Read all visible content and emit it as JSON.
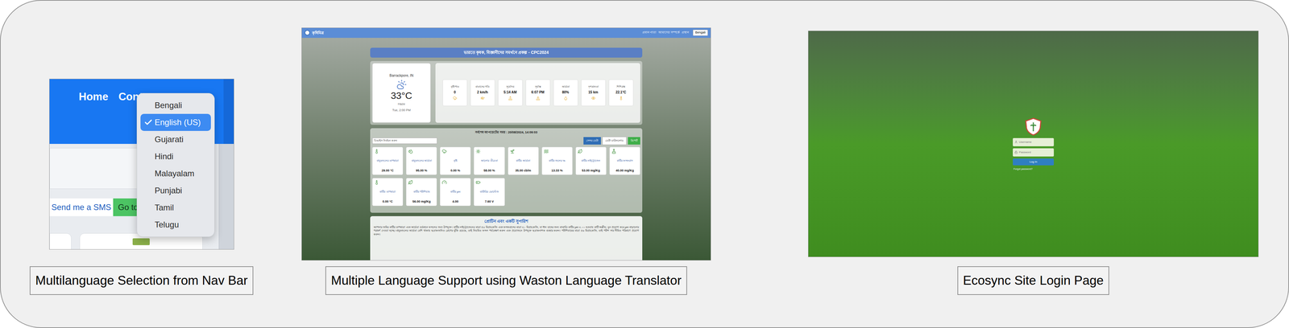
{
  "nav_demo": {
    "nav": [
      "Home",
      "Cont"
    ],
    "sms_button": "Send me a SMS",
    "go_button": "Go to",
    "language_menu": [
      {
        "label": "Bengali",
        "selected": false
      },
      {
        "label": "English (US)",
        "selected": true
      },
      {
        "label": "Gujarati",
        "selected": false
      },
      {
        "label": "Hindi",
        "selected": false
      },
      {
        "label": "Malayalam",
        "selected": false
      },
      {
        "label": "Punjabi",
        "selected": false
      },
      {
        "label": "Tamil",
        "selected": false
      },
      {
        "label": "Telugu",
        "selected": false
      }
    ]
  },
  "translator_demo": {
    "brand": "কৃষিমিত্র",
    "top_links": [
      "প্রধান পাতা",
      "আমাদের সম্পর্কে",
      "প্রস্থান"
    ],
    "language_select": "Bengali",
    "title": "ভারতে কৃষক, বিজ্ঞানীদের সমর্থনে প্রকল্প - CPC2024",
    "weather": {
      "location": "Barrackpore, IN",
      "temperature": "33°C",
      "condition": "Haze",
      "time": "Tue, 2:00 PM",
      "details": [
        {
          "label": "বৃষ্টিপাত",
          "value": "0"
        },
        {
          "label": "বাতাসের গতি",
          "value": "2 km/h"
        },
        {
          "label": "সূর্যোদয়",
          "value": "5:14 AM"
        },
        {
          "label": "সূর্যাস্ত",
          "value": "6:07 PM"
        },
        {
          "label": "আর্দ্রতা",
          "value": "80%"
        },
        {
          "label": "দৃশ্যমানতা",
          "value": "15 km"
        },
        {
          "label": "শিশিরাঙ্ক",
          "value": "22.1°C"
        }
      ]
    },
    "sensor_header": "সর্বশেষ আপডেটের সময় : 20/08/2024, 14:09:03",
    "device_select": "ডিভাইস নির্বাচন করুন",
    "sensor_buttons": [
      {
        "label": "সেন্সর ডেটা",
        "color": "#2f6db5"
      },
      {
        "label": "ডেটা ডাউনলোড",
        "color": "#ffffff"
      },
      {
        "label": "রিপোর্ট",
        "color": "#3fae49"
      }
    ],
    "sensors": [
      {
        "label": "বায়ুমণ্ডলের তাপমাত্রা",
        "value": "29.00 °C"
      },
      {
        "label": "বায়ুমণ্ডলের আর্দ্রতা",
        "value": "95.00 %"
      },
      {
        "label": "বৃষ্টি",
        "value": "0.00 %"
      },
      {
        "label": "আলোর তীব্রতা",
        "value": "58.00 %"
      },
      {
        "label": "মাটির আর্দ্রতা",
        "value": "35.00 cb/m"
      },
      {
        "label": "মাটির জলের %",
        "value": "13.33 %"
      },
      {
        "label": "মাটির নাইট্রোজেন",
        "value": "53.00 mg/Kg"
      },
      {
        "label": "মাটির ফসফরাস",
        "value": "40.00 mg/Kg"
      },
      {
        "label": "মাটির তাপমাত্রা",
        "value": "0.00 °C"
      },
      {
        "label": "মাটির পটাশিয়াম",
        "value": "56.00 mg/Kg"
      },
      {
        "label": "মাটির pH",
        "value": "4.00"
      },
      {
        "label": "ব্যাটারির ভোল্টেজ",
        "value": "7.60 V"
      }
    ],
    "advice_title": "প্রোটিন এবং একটি সুপারিশ",
    "advice_text": "আপনার জমির মাটির তাপমাত্রা এবং আর্দ্রতা বর্তমানে ফসলের জন্য উপযুক্ত। মাটির নাইট্রোজেনের মাত্রা ৫৩ মিগ্রা/কেজি এবং ফসফরাসের মাত্রা ৪০ মিগ্রা/কেজি, যা ধান চাষের জন্য মাঝারি। মাটির pH ৪.০০ হওয়ায় মাটি অম্লীয়; চুন প্রয়োগ করে pH বাড়ানোর পরামর্শ দেওয়া হচ্ছে। বায়ুমণ্ডলের আর্দ্রতা বেশি থাকায় ছত্রাকজনিত রোগের ঝুঁকি রয়েছে, তাই নিয়মিত ফসল পর্যবেক্ষণ করুন এবং প্রয়োজনে উপযুক্ত ছত্রাকনাশক ব্যবহার করুন। পটাশিয়ামের মাত্রা ৫৬ মিগ্রা/কেজি, তাই পটাশ সার সীমিত পরিমাণে প্রয়োগ করুন।"
  },
  "login_demo": {
    "username_placeholder": "Username",
    "password_placeholder": "Password",
    "button": "Log In",
    "forgot": "Forgot password?"
  },
  "captions": [
    "Multilanguage Selection from Nav Bar",
    "Multiple Language Support using Waston Language Translator",
    "Ecosync Site Login Page"
  ]
}
